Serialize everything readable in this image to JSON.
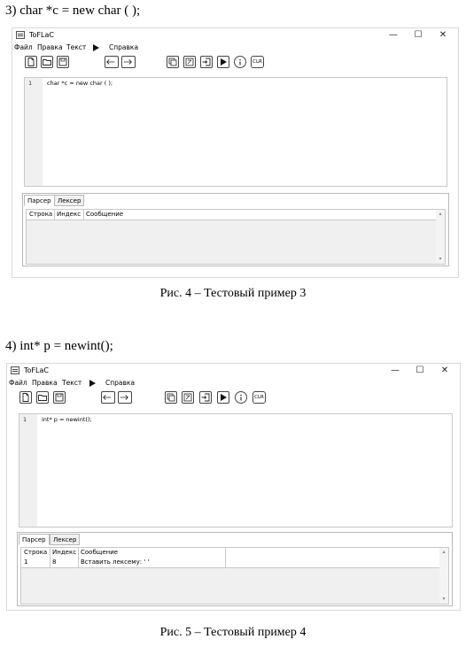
{
  "examples": [
    {
      "heading": "3)  char *c = new char ( );",
      "window": {
        "title": "ToFLaC",
        "controls": [
          "—",
          "☐",
          "✕"
        ],
        "menu": [
          "Файл",
          "Правка",
          "Текст",
          "Справка"
        ],
        "toolbar_icons": [
          "new-file-icon",
          "open-folder-icon",
          "save-icon",
          "undo-arrow-icon",
          "redo-arrow-icon",
          "copy-icon",
          "cut-icon",
          "paste-icon",
          "run-icon",
          "info-icon",
          "clear-icon"
        ],
        "clear_label": "CLR",
        "editor": {
          "line_number": "1",
          "code": "char *c = new char ( );"
        },
        "tabs": [
          "Парсер",
          "Лексер"
        ],
        "active_tab": 0,
        "columns": [
          "Строка",
          "Индекс",
          "Сообщение"
        ],
        "rows": []
      },
      "caption": "Рис. 4 – Тестовый пример 3"
    },
    {
      "heading": "4)  int* p = newint();",
      "window": {
        "title": "ToFLaC",
        "controls": [
          "—",
          "☐",
          "✕"
        ],
        "menu": [
          "Файл",
          "Правка",
          "Текст",
          "Справка"
        ],
        "toolbar_icons": [
          "new-file-icon",
          "open-folder-icon",
          "save-icon",
          "undo-arrow-icon",
          "redo-arrow-icon",
          "copy-icon",
          "cut-icon",
          "paste-icon",
          "run-icon",
          "info-icon",
          "clear-icon"
        ],
        "clear_label": "CLR",
        "editor": {
          "line_number": "1",
          "code": "int* p = newint();"
        },
        "tabs": [
          "Парсер",
          "Лексер"
        ],
        "active_tab": 0,
        "columns": [
          "Строка",
          "Индекс",
          "Сообщение"
        ],
        "rows": [
          {
            "line": "1",
            "index": "8",
            "message": "Вставить лексему: ' '"
          }
        ]
      },
      "caption": "Рис. 5 – Тестовый пример 4"
    }
  ]
}
